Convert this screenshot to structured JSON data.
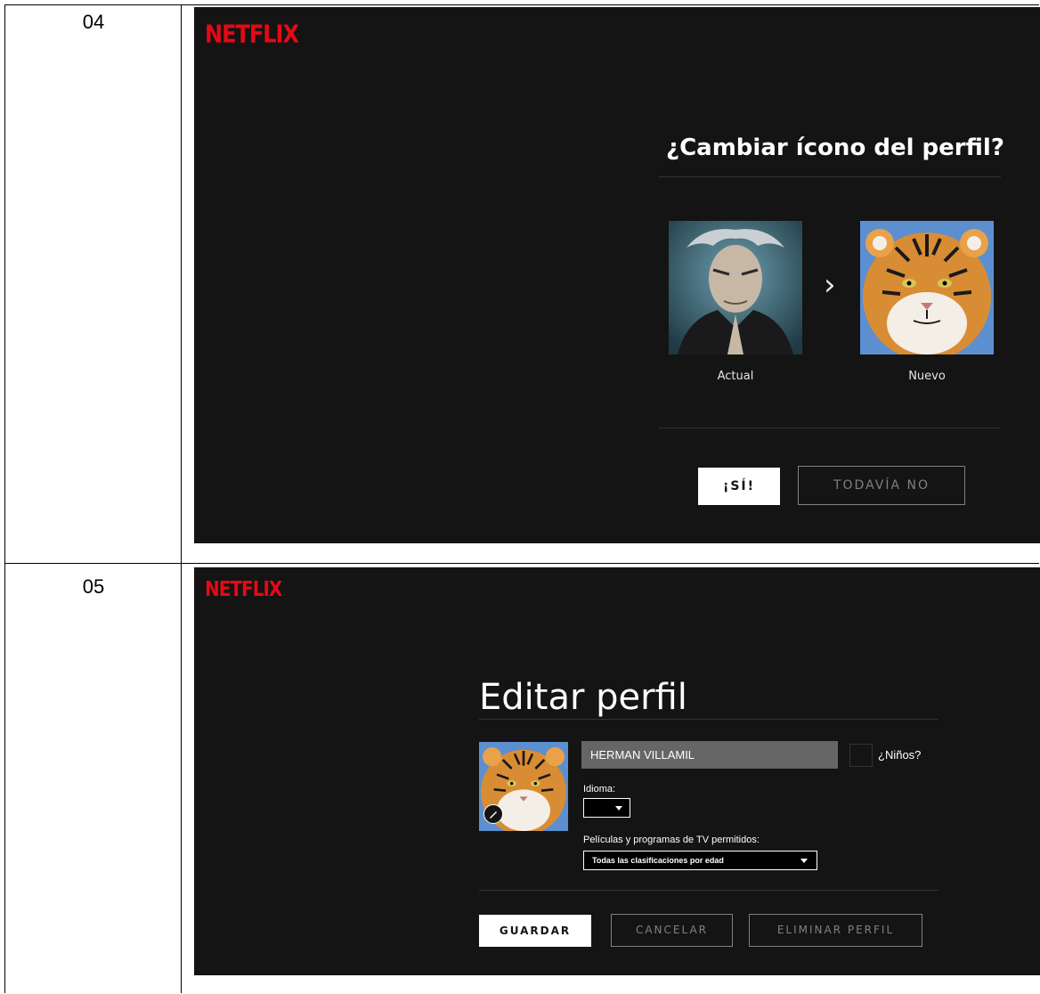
{
  "rows": [
    {
      "number": "04"
    },
    {
      "number": "05"
    }
  ],
  "screen1": {
    "logo": "NETFLIX",
    "title": "¿Cambiar ícono del perfil?",
    "current_label": "Actual",
    "new_label": "Nuevo",
    "chevron": "›",
    "yes_button": "¡SÍ!",
    "not_yet_button": "TODAVÍA NO"
  },
  "screen2": {
    "logo": "NETFLIX",
    "title": "Editar perfil",
    "name_value": "HERMAN VILLAMIL",
    "kids_label": "¿Niños?",
    "language_label": "Idioma:",
    "maturity_label": "Películas y programas de TV permitidos:",
    "maturity_value": "Todas las clasificaciones por edad",
    "save_button": "GUARDAR",
    "cancel_button": "CANCELAR",
    "delete_button": "ELIMINAR PERFIL"
  },
  "colors": {
    "brand_red": "#e50914",
    "screen_bg": "#141414"
  }
}
